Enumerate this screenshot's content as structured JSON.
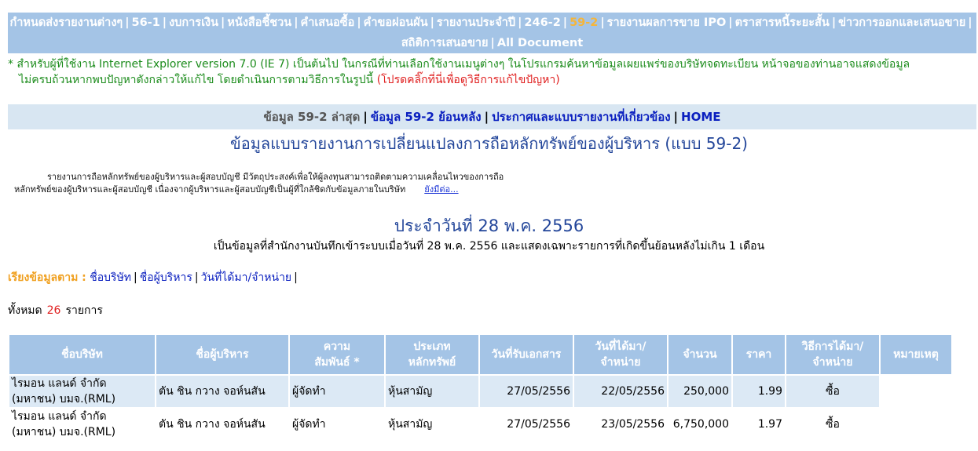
{
  "topnav": {
    "items": [
      "กำหนดส่งรายงานต่างๆ",
      "56-1",
      "งบการเงิน",
      "หนังสือชี้ชวน",
      "คำเสนอซื้อ",
      "คำขอผ่อนผัน",
      "รายงานประจำปี",
      "246-2",
      "59-2",
      "รายงานผลการขาย IPO",
      "ตราสารหนี้ระยะสั้น",
      "ข่าวการออกและเสนอขาย",
      "สถิติการเสนอขาย",
      "All Document"
    ],
    "separator": "|"
  },
  "ie_note": {
    "text": "* สำหรับผู้ที่ใช้งาน Internet Explorer version 7.0 (IE 7) เป็นต้นไป ในกรณีที่ท่านเลือกใช้งานเมนูต่างๆ ในโปรแกรมค้นหาข้อมูลเผยแพร่ของบริษัทจดทะเบียน หน้าจอของท่านอาจแสดงข้อมูล",
    "text2": "ไม่ครบถ้วนหากพบปัญหาดังกล่าวให้แก้ไข โดยดำเนินการตามวิธีการในรูปนี้",
    "link": "(โปรดคลิ๊กที่นี่เพื่อดูวิธีการแก้ไขปัญหา)"
  },
  "subnav": {
    "current": "ข้อมูล 59-2 ล่าสุด",
    "history": "ข้อมูล 59-2 ย้อนหลัง",
    "announcements": "ประกาศและแบบรายงานที่เกี่ยวข้อง",
    "home": "HOME",
    "separator": "|"
  },
  "page_title": "ข้อมูลแบบรายงานการเปลี่ยนแปลงการถือหลักทรัพย์ของผู้บริหาร (แบบ 59-2)",
  "intro": {
    "line1": "รายงานการถือหลักทรัพย์ของผู้บริหารและผู้สอบบัญชี มีวัตถุประสงค์เพื่อให้ผู้ลงทุนสามารถติดตามความเคลื่อนไหวของการถือ",
    "line2": "หลักทรัพย์ของผู้บริหารและผู้สอบบัญชี เนื่องจากผู้บริหารและผู้สอบบัญชีเป็นผู้ที่ใกล้ชิดกับข้อมูลภายในบริษัท",
    "more": "ยังมีต่อ..."
  },
  "date_title": "ประจำวันที่ 28 พ.ค. 2556",
  "date_desc": "เป็นข้อมูลที่สำนักงานบันทึกเข้าระบบเมื่อวันที่ 28 พ.ค. 2556 และแสดงเฉพาะรายการที่เกิดขึ้นย้อนหลังไม่เกิน 1 เดือน",
  "sort": {
    "label": "เรียงข้อมูลตาม :",
    "options": [
      "ชื่อบริษัท",
      "ชื่อผู้บริหาร",
      "วันที่ได้มา/จำหน่าย"
    ],
    "separator": "|"
  },
  "total": {
    "prefix": "ทั้งหมด",
    "count": "26",
    "suffix": "รายการ"
  },
  "table": {
    "headers": [
      "ชื่อบริษัท",
      "ชื่อผู้บริหาร",
      "ความ\nสัมพันธ์ *",
      "ประเภท\nหลักทรัพย์",
      "วันที่รับเอกสาร",
      "วันที่ได้มา/\nจำหน่าย",
      "จำนวน",
      "ราคา",
      "วิธีการได้มา/\nจำหน่าย",
      "หมายเหตุ"
    ],
    "rows": [
      {
        "company": "ไรมอน แลนด์ จำกัด (มหาชน) บมจ.(RML)",
        "executive": "ตัน ชิน กวาง  จอห์นสัน",
        "relation": "ผู้จัดทำ",
        "security": "หุ้นสามัญ",
        "received": "27/05/2556",
        "trade_date": "22/05/2556",
        "amount": "250,000",
        "price": "1.99",
        "method": "ซื้อ"
      },
      {
        "company": "ไรมอน แลนด์ จำกัด (มหาชน) บมจ.(RML)",
        "executive": "ตัน ชิน กวาง  จอห์นสัน",
        "relation": "ผู้จัดทำ",
        "security": "หุ้นสามัญ",
        "received": "27/05/2556",
        "trade_date": "23/05/2556",
        "amount": "6,750,000",
        "price": "1.97",
        "method": "ซื้อ"
      }
    ]
  }
}
